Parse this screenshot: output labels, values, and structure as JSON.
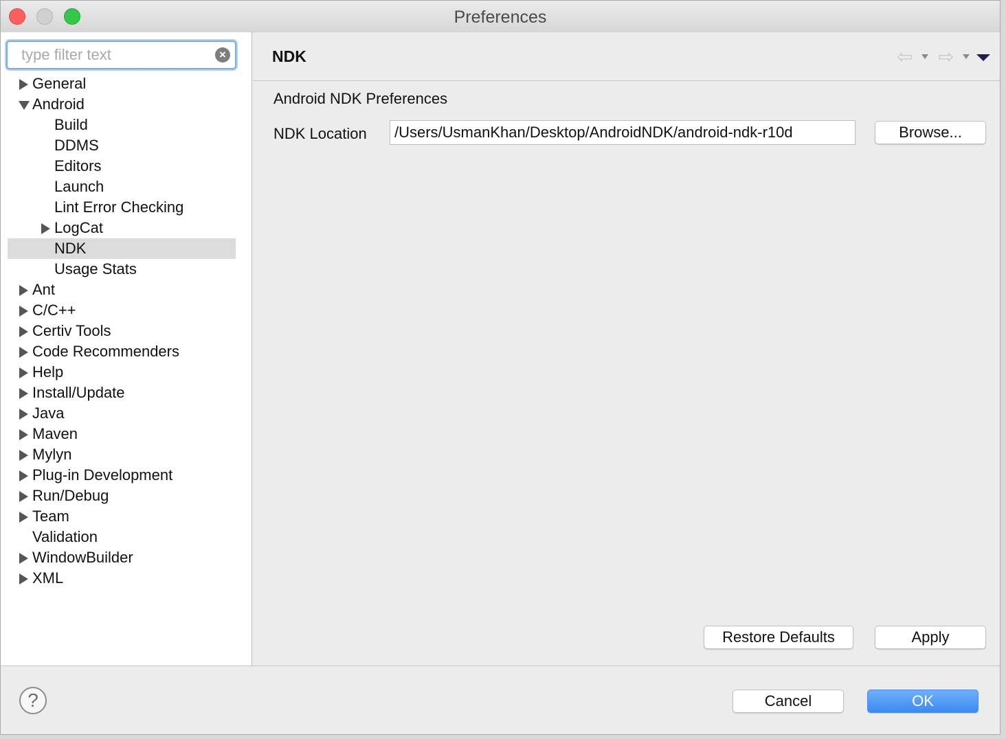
{
  "window": {
    "title": "Preferences"
  },
  "filter": {
    "placeholder": "type filter text",
    "value": ""
  },
  "tree": [
    {
      "label": "General",
      "level": 0,
      "arrow": "right"
    },
    {
      "label": "Android",
      "level": 0,
      "arrow": "down"
    },
    {
      "label": "Build",
      "level": 1,
      "arrow": "none"
    },
    {
      "label": "DDMS",
      "level": 1,
      "arrow": "none"
    },
    {
      "label": "Editors",
      "level": 1,
      "arrow": "none"
    },
    {
      "label": "Launch",
      "level": 1,
      "arrow": "none"
    },
    {
      "label": "Lint Error Checking",
      "level": 1,
      "arrow": "none"
    },
    {
      "label": "LogCat",
      "level": 1,
      "arrow": "right"
    },
    {
      "label": "NDK",
      "level": 1,
      "arrow": "none",
      "selected": true
    },
    {
      "label": "Usage Stats",
      "level": 1,
      "arrow": "none"
    },
    {
      "label": "Ant",
      "level": 0,
      "arrow": "right"
    },
    {
      "label": "C/C++",
      "level": 0,
      "arrow": "right"
    },
    {
      "label": "Certiv Tools",
      "level": 0,
      "arrow": "right"
    },
    {
      "label": "Code Recommenders",
      "level": 0,
      "arrow": "right"
    },
    {
      "label": "Help",
      "level": 0,
      "arrow": "right"
    },
    {
      "label": "Install/Update",
      "level": 0,
      "arrow": "right"
    },
    {
      "label": "Java",
      "level": 0,
      "arrow": "right"
    },
    {
      "label": "Maven",
      "level": 0,
      "arrow": "right"
    },
    {
      "label": "Mylyn",
      "level": 0,
      "arrow": "right"
    },
    {
      "label": "Plug-in Development",
      "level": 0,
      "arrow": "right"
    },
    {
      "label": "Run/Debug",
      "level": 0,
      "arrow": "right"
    },
    {
      "label": "Team",
      "level": 0,
      "arrow": "right"
    },
    {
      "label": "Validation",
      "level": 0,
      "arrow": "none"
    },
    {
      "label": "WindowBuilder",
      "level": 0,
      "arrow": "right"
    },
    {
      "label": "XML",
      "level": 0,
      "arrow": "right"
    }
  ],
  "page": {
    "title": "NDK",
    "section_title": "Android NDK Preferences",
    "ndk_location_label": "NDK Location",
    "ndk_location_value": "/Users/UsmanKhan/Desktop/AndroidNDK/android-ndk-r10d",
    "browse_label": "Browse...",
    "restore_defaults_label": "Restore Defaults",
    "apply_label": "Apply"
  },
  "nav_icons": {
    "back": "back-arrow-icon",
    "forward": "forward-arrow-icon",
    "menu": "view-menu-icon"
  },
  "footer": {
    "cancel_label": "Cancel",
    "ok_label": "OK",
    "help_icon": "help-icon"
  },
  "colors": {
    "ok_button": "#3b89f2",
    "selection": "#dcdcdc",
    "filter_focus": "#7fa8e0"
  }
}
